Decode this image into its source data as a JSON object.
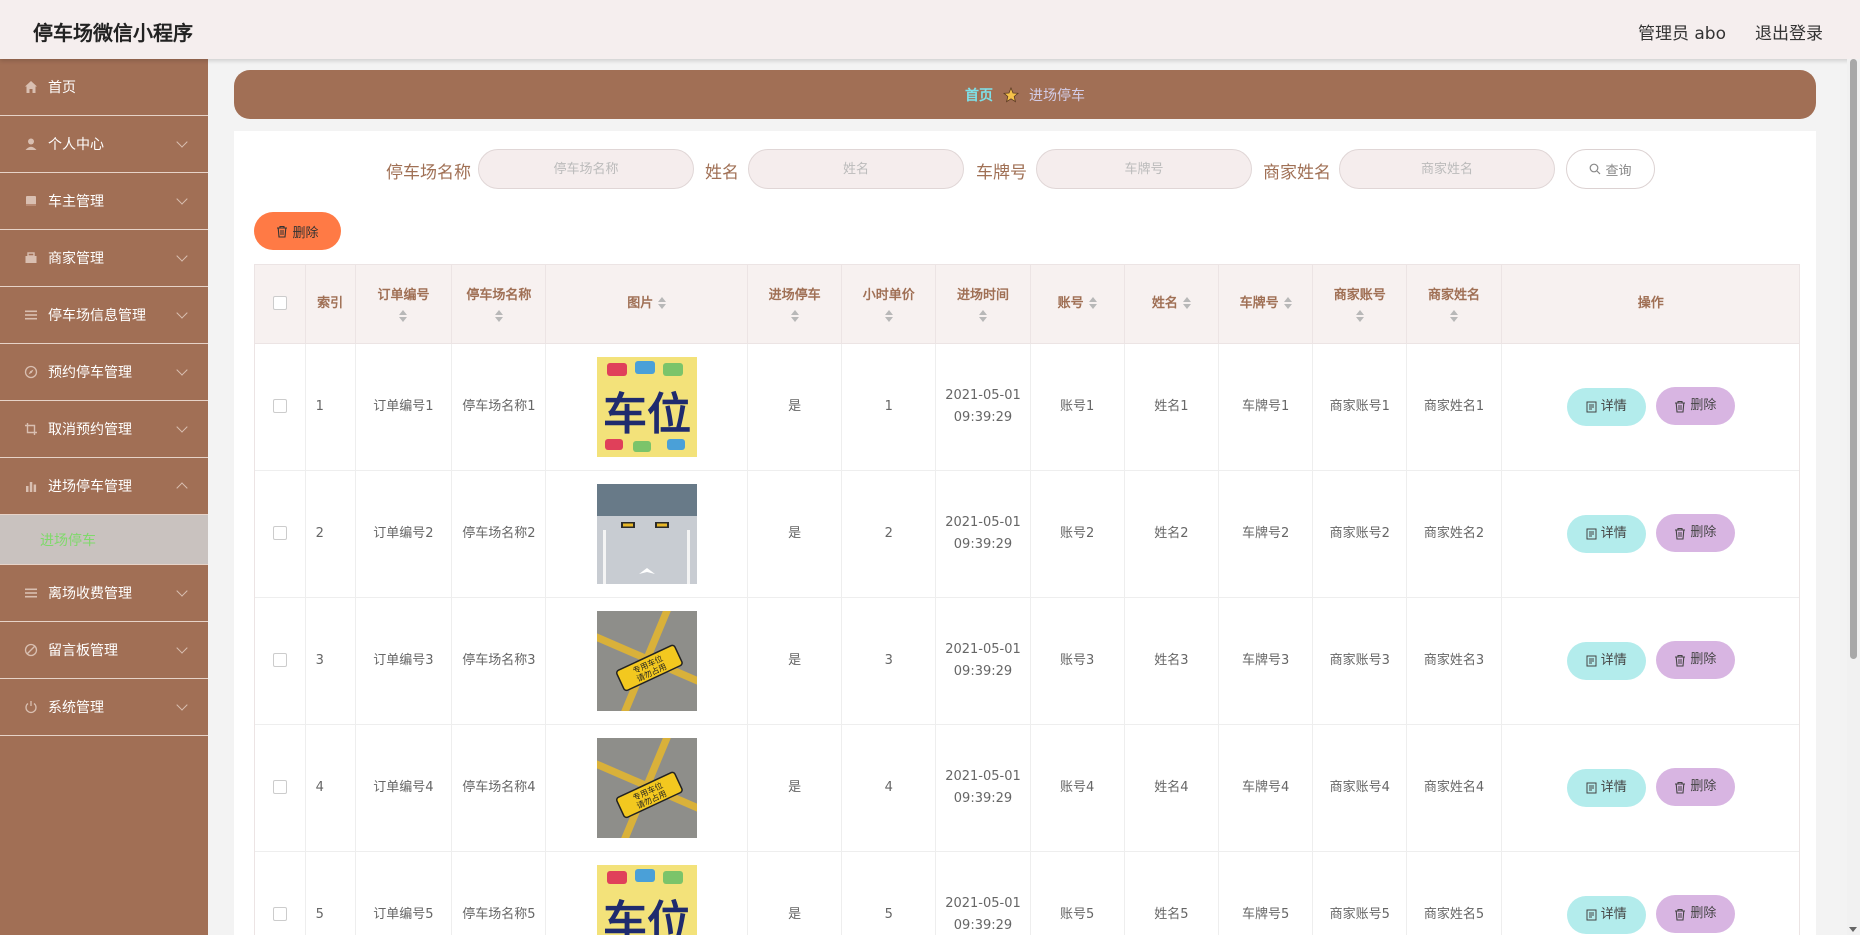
{
  "app": {
    "title": "停车场微信小程序",
    "user_label": "管理员 abo",
    "logout_label": "退出登录"
  },
  "sidebar": {
    "items": [
      {
        "label": "首页",
        "icon": "home-icon"
      },
      {
        "label": "个人中心",
        "icon": "user-icon"
      },
      {
        "label": "车主管理",
        "icon": "book-icon"
      },
      {
        "label": "商家管理",
        "icon": "shop-icon"
      },
      {
        "label": "停车场信息管理",
        "icon": "list-icon"
      },
      {
        "label": "预约停车管理",
        "icon": "compass-icon"
      },
      {
        "label": "取消预约管理",
        "icon": "crop-icon"
      },
      {
        "label": "进场停车管理",
        "icon": "bar-chart-icon"
      },
      {
        "label": "离场收费管理",
        "icon": "list-icon"
      },
      {
        "label": "留言板管理",
        "icon": "no-entry-icon"
      },
      {
        "label": "系统管理",
        "icon": "power-icon"
      }
    ],
    "active_sub": "进场停车"
  },
  "breadcrumb": {
    "home": "首页",
    "current": "进场停车"
  },
  "search": {
    "fields": [
      {
        "label": "停车场名称",
        "placeholder": "停车场名称"
      },
      {
        "label": "姓名",
        "placeholder": "姓名"
      },
      {
        "label": "车牌号",
        "placeholder": "车牌号"
      },
      {
        "label": "商家姓名",
        "placeholder": "商家姓名"
      }
    ],
    "query_label": "查询"
  },
  "bulk_delete_label": "删除",
  "table": {
    "headers": {
      "index": "索引",
      "order_no": "订单编号",
      "lot_name": "停车场名称",
      "image": "图片",
      "entered": "进场停车",
      "hourly_price": "小时单价",
      "entry_time": "进场时间",
      "account": "账号",
      "name": "姓名",
      "plate": "车牌号",
      "merchant_account": "商家账号",
      "merchant_name": "商家姓名",
      "actions": "操作"
    },
    "rows": [
      {
        "index": "1",
        "order_no": "订单编号1",
        "lot_name": "停车场名称1",
        "image": "parking-sign-cartoon",
        "entered": "是",
        "hourly_price": "1",
        "entry_time": "2021-05-01 09:39:29",
        "account": "账号1",
        "name": "姓名1",
        "plate": "车牌号1",
        "merchant_account": "商家账号1",
        "merchant_name": "商家姓名1"
      },
      {
        "index": "2",
        "order_no": "订单编号2",
        "lot_name": "停车场名称2",
        "image": "parking-space-photo",
        "entered": "是",
        "hourly_price": "2",
        "entry_time": "2021-05-01 09:39:29",
        "account": "账号2",
        "name": "姓名2",
        "plate": "车牌号2",
        "merchant_account": "商家账号2",
        "merchant_name": "商家姓名2"
      },
      {
        "index": "3",
        "order_no": "订单编号3",
        "lot_name": "停车场名称3",
        "image": "reserved-floor-sign",
        "entered": "是",
        "hourly_price": "3",
        "entry_time": "2021-05-01 09:39:29",
        "account": "账号3",
        "name": "姓名3",
        "plate": "车牌号3",
        "merchant_account": "商家账号3",
        "merchant_name": "商家姓名3"
      },
      {
        "index": "4",
        "order_no": "订单编号4",
        "lot_name": "停车场名称4",
        "image": "reserved-floor-sign",
        "entered": "是",
        "hourly_price": "4",
        "entry_time": "2021-05-01 09:39:29",
        "account": "账号4",
        "name": "姓名4",
        "plate": "车牌号4",
        "merchant_account": "商家账号4",
        "merchant_name": "商家姓名4"
      },
      {
        "index": "5",
        "order_no": "订单编号5",
        "lot_name": "停车场名称5",
        "image": "parking-sign-cartoon",
        "entered": "是",
        "hourly_price": "5",
        "entry_time": "2021-05-01 09:39:29",
        "account": "账号5",
        "name": "姓名5",
        "plate": "车牌号5",
        "merchant_account": "商家账号5",
        "merchant_name": "商家姓名5"
      }
    ],
    "detail_label": "详情",
    "delete_label": "删除",
    "image_word": "车位",
    "floor_sign_lines": [
      "专用车位",
      "请勿占用"
    ]
  },
  "colors": {
    "sidebar_bg": "#a16f55",
    "accent_cyan": "#b3ecec",
    "accent_purple": "#d8b5e2",
    "danger_orange": "#ff7a45"
  }
}
